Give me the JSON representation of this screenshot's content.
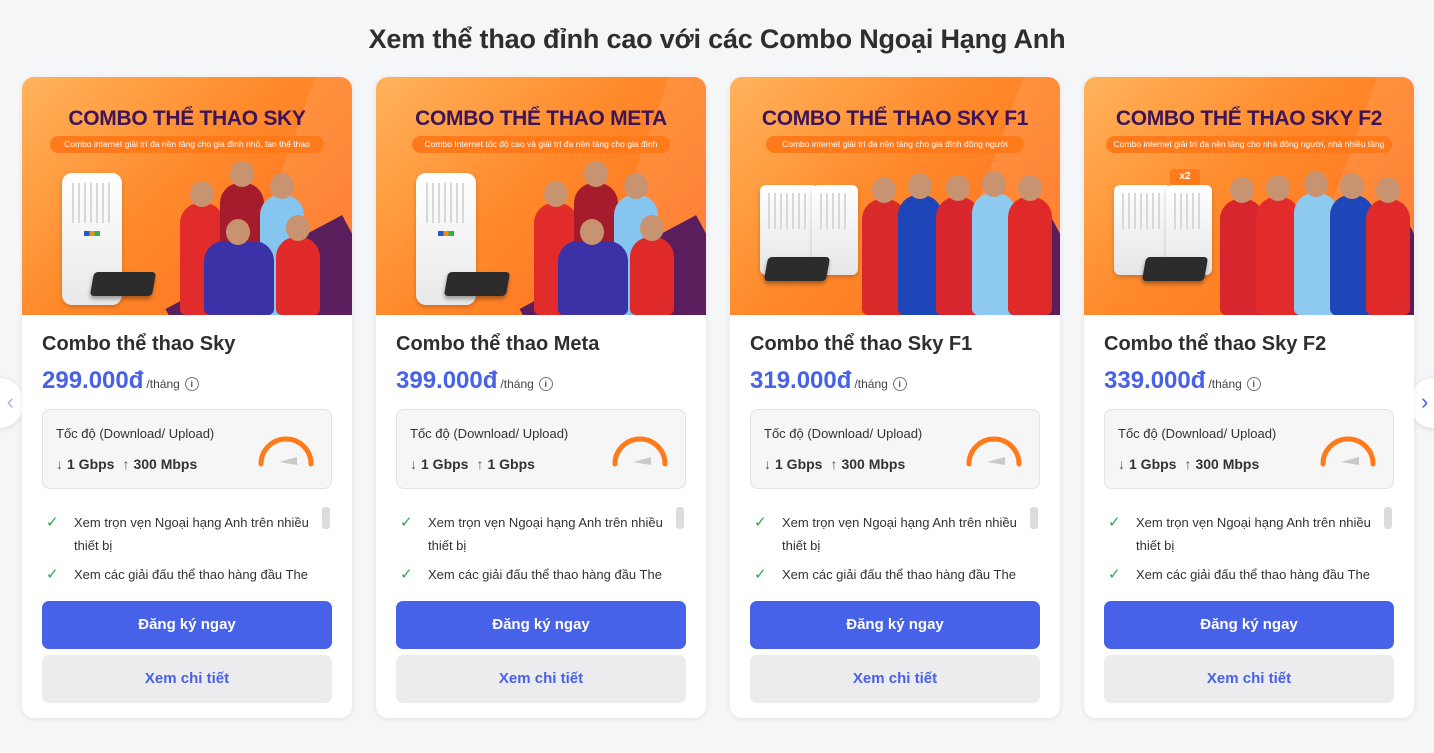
{
  "page": {
    "title": "Xem thể thao đỉnh cao với các Combo Ngoại Hạng Anh"
  },
  "navigation": {
    "prev_icon": "chevron-left-icon",
    "next_icon": "chevron-right-icon"
  },
  "colors": {
    "primary": "#4761e8",
    "banner_orange": "#ff8a2b",
    "banner_title": "#3d1458",
    "check_green": "#2ea84a",
    "gauge_orange": "#ff7a1a"
  },
  "cards": [
    {
      "banner_title": "COMBO THỂ THAO SKY",
      "banner_subtitle": "Combo internet giải trí đa nền tảng cho gia đình nhỏ, fan thể thao",
      "name": "Combo thể thao Sky",
      "price": "299.000đ",
      "period": "/tháng",
      "speed_label": "Tốc độ (Download/ Upload)",
      "download": "1 Gbps",
      "upload": "300 Mbps",
      "features": [
        "Xem trọn vẹn Ngoại hạng Anh trên nhiều thiết bị",
        "Xem các giải đấu thể thao hàng đầu The"
      ],
      "register_label": "Đăng ký ngay",
      "detail_label": "Xem chi tiết"
    },
    {
      "banner_title": "COMBO THỂ THAO META",
      "banner_subtitle": "Combo Internet tốc độ cao và giải trí đa nền tảng cho gia đình",
      "name": "Combo thể thao Meta",
      "price": "399.000đ",
      "period": "/tháng",
      "speed_label": "Tốc độ (Download/ Upload)",
      "download": "1 Gbps",
      "upload": "1 Gbps",
      "features": [
        "Xem trọn vẹn Ngoại hạng Anh trên nhiều thiết bị",
        "Xem các giải đấu thể thao hàng đầu The"
      ],
      "register_label": "Đăng ký ngay",
      "detail_label": "Xem chi tiết"
    },
    {
      "banner_title": "COMBO THỂ THAO SKY F1",
      "banner_subtitle": "Combo internet giải trí đa nền tảng cho gia đình đông người",
      "name": "Combo thể thao Sky F1",
      "price": "319.000đ",
      "period": "/tháng",
      "speed_label": "Tốc độ (Download/ Upload)",
      "download": "1 Gbps",
      "upload": "300 Mbps",
      "features": [
        "Xem trọn vẹn Ngoại hạng Anh trên nhiều thiết bị",
        "Xem các giải đấu thể thao hàng đầu The"
      ],
      "register_label": "Đăng ký ngay",
      "detail_label": "Xem chi tiết"
    },
    {
      "banner_title": "COMBO THỂ THAO SKY F2",
      "banner_subtitle": "Combo internet giải trí đa nền tảng cho nhà đông người, nhà nhiều tầng",
      "badge": "x2",
      "name": "Combo thể thao Sky F2",
      "price": "339.000đ",
      "period": "/tháng",
      "speed_label": "Tốc độ (Download/ Upload)",
      "download": "1 Gbps",
      "upload": "300 Mbps",
      "features": [
        "Xem trọn vẹn Ngoại hạng Anh trên nhiều thiết bị",
        "Xem các giải đấu thể thao hàng đầu The"
      ],
      "register_label": "Đăng ký ngay",
      "detail_label": "Xem chi tiết"
    }
  ]
}
